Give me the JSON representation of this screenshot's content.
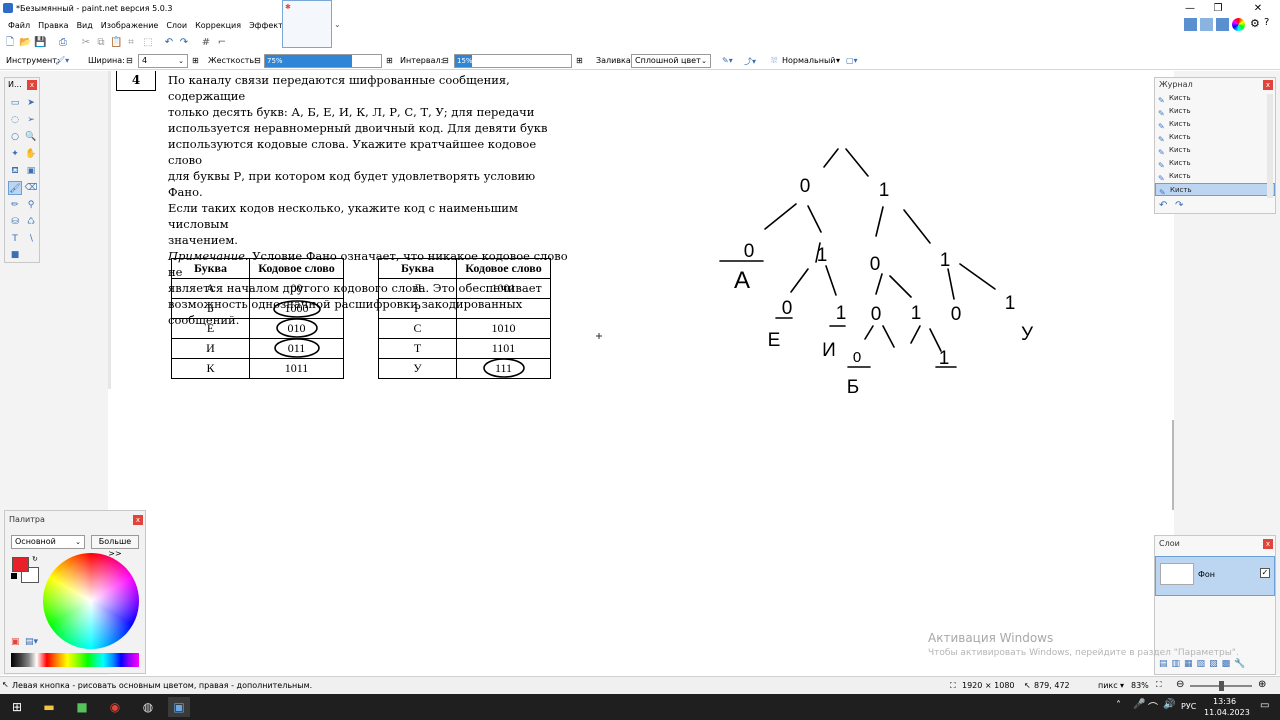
{
  "window": {
    "title": "*Безымянный - paint.net версия 5.0.3"
  },
  "menu": [
    "Файл",
    "Правка",
    "Вид",
    "Изображение",
    "Слои",
    "Коррекция",
    "Эффекты"
  ],
  "options": {
    "tool_label": "Инструмент:",
    "width_label": "Ширина:",
    "width_value": "4",
    "hardness_label": "Жесткость:",
    "hardness_value": "75%",
    "hardness_fraction": 0.75,
    "interval_label": "Интервал:",
    "interval_value": "15%",
    "interval_fraction": 0.15,
    "fill_label": "Заливка:",
    "fill_value": "Сплошной цвет",
    "blend_value": "Нормальный"
  },
  "tools_panel": {
    "title": "И..."
  },
  "history_panel": {
    "title": "Журнал",
    "items": [
      "Кисть",
      "Кисть",
      "Кисть",
      "Кисть",
      "Кисть",
      "Кисть",
      "Кисть",
      "Кисть"
    ]
  },
  "palette_panel": {
    "title": "Палитра",
    "mode": "Основной",
    "more_button": "Больше >>",
    "primary_color": "#e8202a",
    "secondary_color": "#ffffff"
  },
  "layers_panel": {
    "title": "Слои",
    "layer_name": "Фон"
  },
  "document": {
    "question_number": "4",
    "paragraph_lines": [
      "По каналу связи передаются шифрованные сообщения, содержащие",
      "только десять букв: А, Б, Е, И, К, Л, Р, С, Т, У; для передачи",
      "используется неравномерный двоичный код. Для девяти букв",
      "используются кодовые слова. Укажите кратчайшее кодовое слово",
      "для буквы Р, при котором код будет удовлетворять условию Фано.",
      "Если таких кодов несколько, укажите код с наименьшим числовым",
      "значением."
    ],
    "note_label": "Примечание.",
    "note_lines": [
      " Условие Фано означает, что никакое кодовое слово не",
      "является началом другого кодового слова. Это обеспечивает",
      "возможность однозначной расшифровки закодированных",
      "сообщений."
    ],
    "table_headers": [
      "Буква",
      "Кодовое слово"
    ],
    "table1": [
      [
        "А",
        "00"
      ],
      [
        "Б",
        "1000"
      ],
      [
        "Е",
        "010"
      ],
      [
        "И",
        "011"
      ],
      [
        "К",
        "1011"
      ]
    ],
    "table2": [
      [
        "Л",
        "1001"
      ],
      [
        "Р",
        ""
      ],
      [
        "С",
        "1010"
      ],
      [
        "Т",
        "1101"
      ],
      [
        "У",
        "111"
      ]
    ]
  },
  "tree_labels": {
    "n0": "0",
    "n1": "1",
    "n00": "0",
    "A": "А",
    "n01": "1",
    "n10": "0",
    "n11": "1",
    "n010": "0",
    "E": "Е",
    "n011": "1",
    "I": "И",
    "n100": "0",
    "n101": "1",
    "n110": "0",
    "n111": "1",
    "U": "У",
    "n1000": "0",
    "B": "Б",
    "n1001": "1"
  },
  "watermark": {
    "line1": "Активация Windows",
    "line2": "Чтобы активировать Windows, перейдите в раздел \"Параметры\"."
  },
  "status": {
    "hint": "Левая кнопка - рисовать основным цветом, правая - дополнительным.",
    "image_size": "1920 × 1080",
    "cursor_pos": "879, 472",
    "units": "пикс",
    "zoom": "83%"
  },
  "taskbar": {
    "lang": "РУС",
    "time": "13:36",
    "date": "11.04.2023"
  }
}
